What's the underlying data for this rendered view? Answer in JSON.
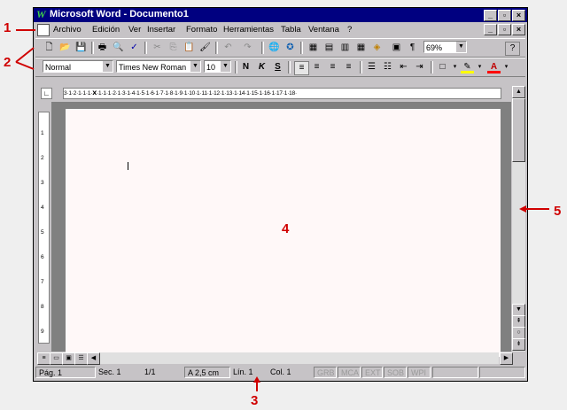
{
  "window": {
    "title": "Microsoft Word - Documento1",
    "app_icon": "word-icon"
  },
  "menu": {
    "items": [
      "Archivo",
      "Edición",
      "Ver",
      "Insertar",
      "Formato",
      "Herramientas",
      "Tabla",
      "Ventana",
      "?"
    ]
  },
  "toolbar_standard": {
    "zoom": "69%",
    "help": "?",
    "pilcrow": "¶"
  },
  "toolbar_format": {
    "style": "Normal",
    "font": "Times New Roman",
    "size": "10",
    "bold": "N",
    "italic": "K",
    "underline": "S",
    "font_color": "A"
  },
  "ruler": {
    "h_marks": "3·1·2·1·1·1·𝗫·1·1·1·2·1·3·1·4·1·5·1·6·1·7·1·8·1·9·1·10·1·11·1·12·1·13·1·14·1·15·1·16·1·17·1·18·",
    "v_marks": [
      "1",
      "2",
      "3",
      "4",
      "5",
      "6",
      "7",
      "8",
      "9"
    ]
  },
  "status": {
    "page": "Pág. 1",
    "section": "Sec. 1",
    "pages": "1/1",
    "at": "A 2,5 cm",
    "line": "Lín. 1",
    "col": "Col. 1",
    "grb": "GRB",
    "mca": "MCA",
    "ext": "EXT",
    "sob": "SOB",
    "wpi": "WPI"
  },
  "annotations": {
    "a1": "1",
    "a2": "2",
    "a3": "3",
    "a4": "4",
    "a5": "5"
  }
}
